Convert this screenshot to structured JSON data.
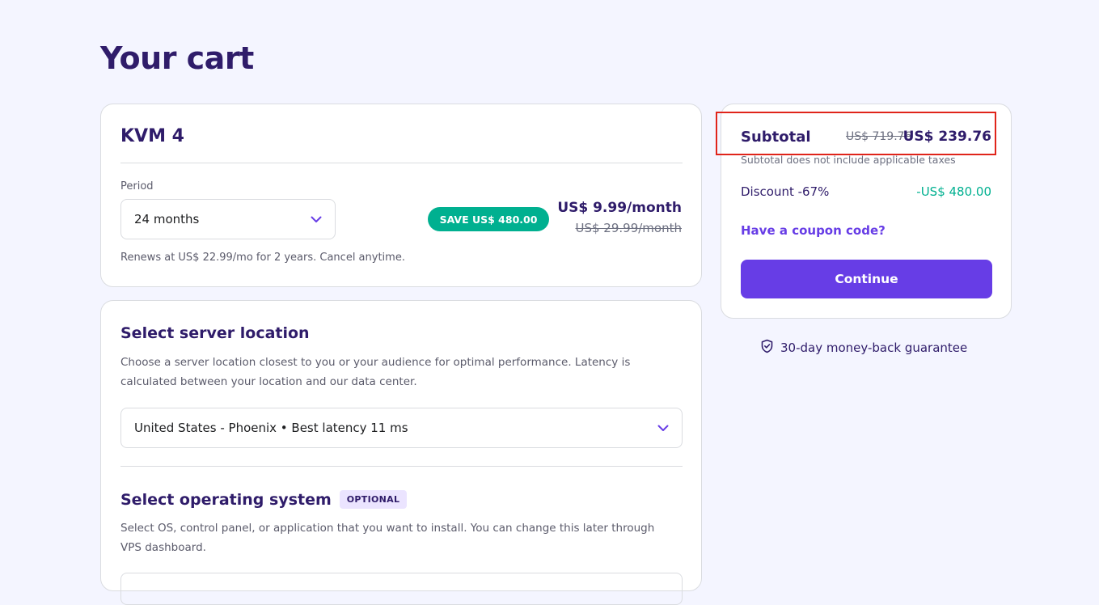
{
  "page": {
    "title": "Your cart"
  },
  "product": {
    "name": "KVM 4",
    "period_label": "Period",
    "period_value": "24 months",
    "save_badge": "SAVE US$ 480.00",
    "price_now": "US$ 9.99/month",
    "price_old": "US$ 29.99/month",
    "renew_note": "Renews at US$ 22.99/mo for 2 years. Cancel anytime."
  },
  "server_location": {
    "title": "Select server location",
    "description": "Choose a server location closest to you or your audience for optimal performance. Latency is calculated between your location and our data center.",
    "selected": "United States - Phoenix • Best latency 11 ms"
  },
  "operating_system": {
    "title": "Select operating system",
    "badge": "OPTIONAL",
    "description": "Select OS, control panel, or application that you want to install. You can change this later through VPS dashboard."
  },
  "summary": {
    "subtotal_label": "Subtotal",
    "subtotal_old": "US$ 719.76",
    "subtotal_new": "US$ 239.76",
    "tax_note": "Subtotal does not include applicable taxes",
    "discount_label": "Discount -67%",
    "discount_value": "-US$ 480.00",
    "coupon_link": "Have a coupon code?",
    "continue_label": "Continue"
  },
  "guarantee": {
    "text": "30-day money-back guarantee"
  },
  "colors": {
    "brand_purple": "#673de6",
    "heading_navy": "#2f1c6a",
    "success_green": "#00b090",
    "highlight_red": "#e0241a",
    "page_background": "#f4f5ff"
  },
  "icons": [
    "chevron-down-icon",
    "shield-check-icon"
  ]
}
